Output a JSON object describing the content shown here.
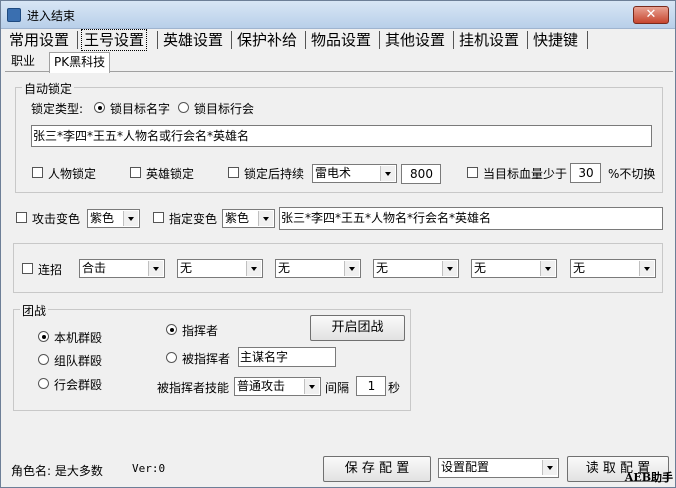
{
  "window": {
    "title": "进入结束",
    "close_label": "✕"
  },
  "tabs": [
    "常用设置",
    "王号设置",
    "英雄设置",
    "保护补给",
    "物品设置",
    "其他设置",
    "挂机设置",
    "快捷键"
  ],
  "subtabs": [
    "职业",
    "PK黑科技"
  ],
  "auto_lock": {
    "legend": "自动锁定",
    "lock_type_label": "锁定类型:",
    "radio_name": "锁目标名字",
    "radio_guild": "锁目标行会",
    "names_value": "张三*李四*王五*人物名或行会名*英雄名",
    "person_lock": "人物锁定",
    "hero_lock": "英雄锁定",
    "lock_continue": "锁定后持续",
    "skill_value": "雷电术",
    "duration_value": "800",
    "hp_label": "当目标血量少于",
    "hp_value": "30",
    "no_switch_label": "%不切换"
  },
  "color_row": {
    "attack_color_label": "攻击变色",
    "attack_color_value": "紫色",
    "assign_color_label": "指定变色",
    "assign_color_value": "紫色",
    "names_value": "张三*李四*王五*人物名*行会名*英雄名"
  },
  "combo": {
    "label": "连招",
    "slots": [
      "合击",
      "无",
      "无",
      "无",
      "无",
      "无"
    ]
  },
  "team": {
    "legend": "团战",
    "modes": [
      "本机群殴",
      "组队群殴",
      "行会群殴"
    ],
    "commander": "指挥者",
    "commanded": "被指挥者",
    "commander_name": "主谋名字",
    "start_button": "开启团战",
    "skill_label": "被指挥者技能",
    "skill_value": "普通攻击",
    "interval_label": "间隔",
    "interval_value": "1",
    "interval_unit": "秒"
  },
  "footer": {
    "role_label": "角色名: 是大多数",
    "version": "Ver:0",
    "save_button": "保 存 配 置",
    "config_select": "设置配置",
    "load_button": "读 取 配 置",
    "brand": "AEB助手"
  }
}
